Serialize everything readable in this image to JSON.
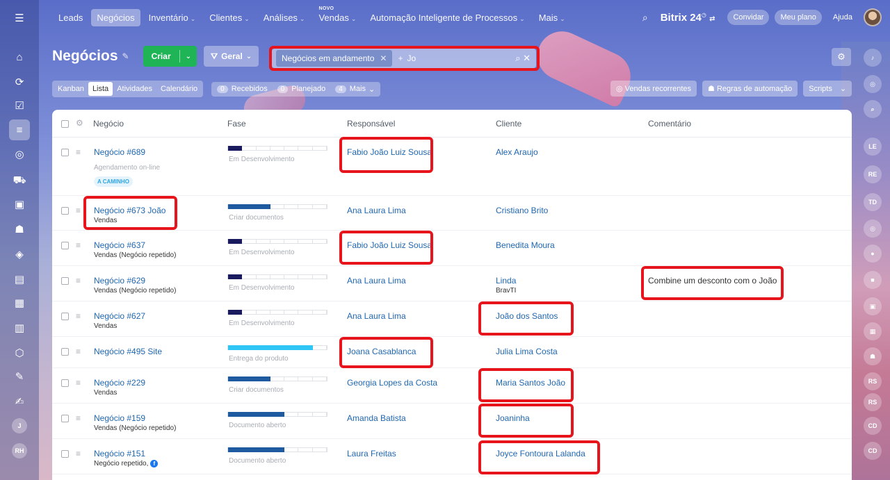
{
  "nav": {
    "items": [
      {
        "label": "Leads",
        "chevron": false,
        "active": false
      },
      {
        "label": "Negócios",
        "chevron": false,
        "active": true
      },
      {
        "label": "Inventário",
        "chevron": true,
        "active": false
      },
      {
        "label": "Clientes",
        "chevron": true,
        "active": false
      },
      {
        "label": "Análises",
        "chevron": true,
        "active": false
      },
      {
        "label": "Vendas",
        "chevron": true,
        "active": false,
        "badge": "NOVO"
      },
      {
        "label": "Automação Inteligente de Processos",
        "chevron": true,
        "active": false
      },
      {
        "label": "Mais",
        "chevron": true,
        "active": false
      }
    ],
    "brand": "Bitrix 24",
    "invite": "Convidar",
    "plan": "Meu plano",
    "help": "Ajuda"
  },
  "header": {
    "title": "Negócios",
    "create": "Criar",
    "filter_preset": "Geral",
    "search_tag": "Negócios em andamento",
    "search_plus": "+",
    "search_text": "Jo"
  },
  "views": {
    "tabs": [
      "Kanban",
      "Lista",
      "Atividades",
      "Calendário"
    ],
    "active_tab": "Lista",
    "counters": [
      {
        "num": "0",
        "label": "Recebidos"
      },
      {
        "num": "0",
        "label": "Planejado"
      },
      {
        "num": "4",
        "label": "Mais"
      }
    ],
    "tools": [
      "Vendas recorrentes",
      "Regras de automação",
      "Scripts"
    ]
  },
  "table": {
    "columns": [
      "Negócio",
      "Fase",
      "Responsável",
      "Cliente",
      "Comentário"
    ],
    "rows": [
      {
        "deal": "Negócio #689",
        "sub": "Agendamento on-line",
        "tag": "A CAMINHO",
        "stage": "Em Desenvolvimento",
        "progress": 0.14,
        "color": "#1a1a5e",
        "owner": "Fabio João Luiz Sousa",
        "client": "Alex Araujo",
        "client_sub": "",
        "comment": ""
      },
      {
        "deal": "Negócio #673 João",
        "sub": "Vendas",
        "tag": "",
        "stage": "Criar documentos",
        "progress": 0.43,
        "color": "#1e5aa0",
        "owner": "Ana Laura Lima",
        "client": "Cristiano Brito",
        "client_sub": "",
        "comment": ""
      },
      {
        "deal": "Negócio #637",
        "sub": "Vendas (Negócio repetido)",
        "tag": "",
        "stage": "Em Desenvolvimento",
        "progress": 0.14,
        "color": "#1a1a5e",
        "owner": "Fabio João Luiz Sousa",
        "client": "Benedita Moura",
        "client_sub": "",
        "comment": ""
      },
      {
        "deal": "Negócio #629",
        "sub": "Vendas (Negócio repetido)",
        "tag": "",
        "stage": "Em Desenvolvimento",
        "progress": 0.14,
        "color": "#1a1a5e",
        "owner": "Ana Laura Lima",
        "client": "Linda",
        "client_sub": "BravTI",
        "comment": "Combine um desconto com o João"
      },
      {
        "deal": "Negócio #627",
        "sub": "Vendas",
        "tag": "",
        "stage": "Em Desenvolvimento",
        "progress": 0.14,
        "color": "#1a1a5e",
        "owner": "Ana Laura Lima",
        "client": "João dos Santos",
        "client_sub": "",
        "comment": ""
      },
      {
        "deal": "Negócio #495 Site",
        "sub": "",
        "tag": "",
        "stage": "Entrega do produto",
        "progress": 0.86,
        "color": "#2fc6f6",
        "owner": "Joana Casablanca",
        "client": "Julia Lima Costa",
        "client_sub": "",
        "comment": ""
      },
      {
        "deal": "Negócio #229",
        "sub": "Vendas",
        "tag": "",
        "stage": "Criar documentos",
        "progress": 0.43,
        "color": "#1e5aa0",
        "owner": "Georgia Lopes da Costa",
        "client": "Maria Santos João",
        "client_sub": "",
        "comment": ""
      },
      {
        "deal": "Negócio #159",
        "sub": "Vendas (Negócio repetido)",
        "tag": "",
        "stage": "Documento aberto",
        "progress": 0.57,
        "color": "#1e5aa0",
        "owner": "Amanda Batista",
        "client": "Joaninha",
        "client_sub": "",
        "comment": ""
      },
      {
        "deal": "Negócio #151",
        "sub": "Negócio repetido,",
        "tag": "",
        "stage": "Documento aberto",
        "progress": 0.57,
        "color": "#1e5aa0",
        "owner": "Laura Freitas",
        "client": "Joyce Fontoura Lalanda",
        "client_sub": "",
        "comment": ""
      }
    ]
  },
  "sidebar": {
    "avatars": [
      "J",
      "RH"
    ]
  },
  "rail": {
    "items": [
      "LE",
      "RE",
      "TD",
      "RS",
      "RS",
      "CD",
      "CD"
    ]
  },
  "colors": {
    "highlight": "#e8141c",
    "create": "#1fb556",
    "link": "#2067b0"
  }
}
